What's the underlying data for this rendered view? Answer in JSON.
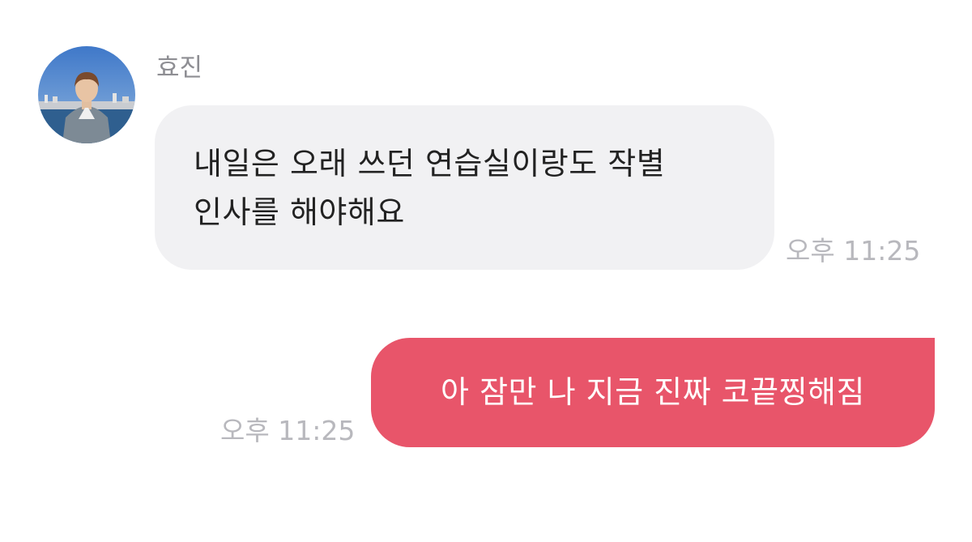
{
  "incoming": {
    "sender_name": "효진",
    "lines": [
      "내일은 오래 쓰던 연습실이랑도 작별",
      "인사를 해야해요"
    ],
    "time": "오후 11:25"
  },
  "outgoing": {
    "text": "아 잠만 나 지금 진짜 코끝찡해짐",
    "time": "오후 11:25"
  },
  "colors": {
    "incoming_bubble": "#f1f1f3",
    "outgoing_bubble": "#e8556a",
    "timestamp": "#b8b8bd",
    "sender_name": "#8e8e93"
  },
  "icons": {
    "avatar": "profile-photo-avatar"
  }
}
